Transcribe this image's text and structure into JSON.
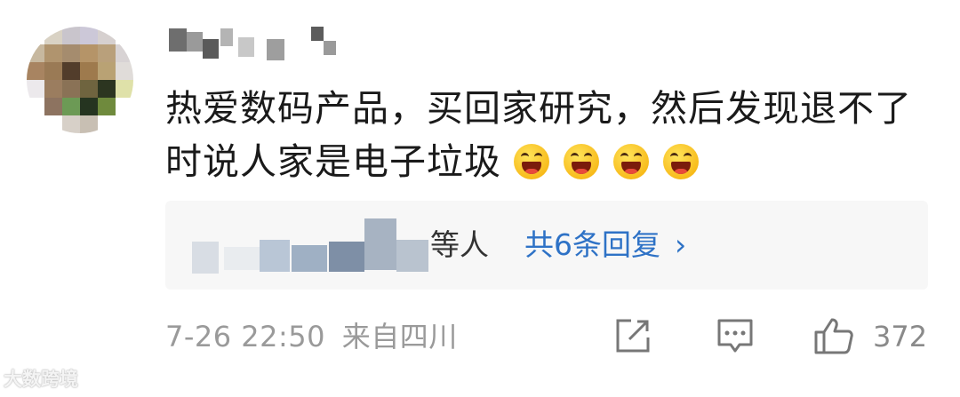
{
  "comment": {
    "text": "热爱数码产品，买回家研究，然后发现退不了时说人家是电子垃圾",
    "emoji_count": 4,
    "emoji_icon": "laughing-grin-emoji"
  },
  "replies": {
    "suffix": "等人",
    "count_label": "共6条回复",
    "chevron": "›"
  },
  "meta": {
    "timestamp": "7-26 22:50",
    "location": "来自四川"
  },
  "actions": {
    "share_icon": "share-icon",
    "comment_icon": "comment-icon",
    "like_icon": "thumbs-up-icon",
    "like_count": "372"
  },
  "watermark": {
    "text": "大数跨境"
  },
  "colors": {
    "link": "#2e72c6",
    "text": "#1a1a1a",
    "meta": "#9a9a9a",
    "reply_bg": "#f7f7f7"
  }
}
